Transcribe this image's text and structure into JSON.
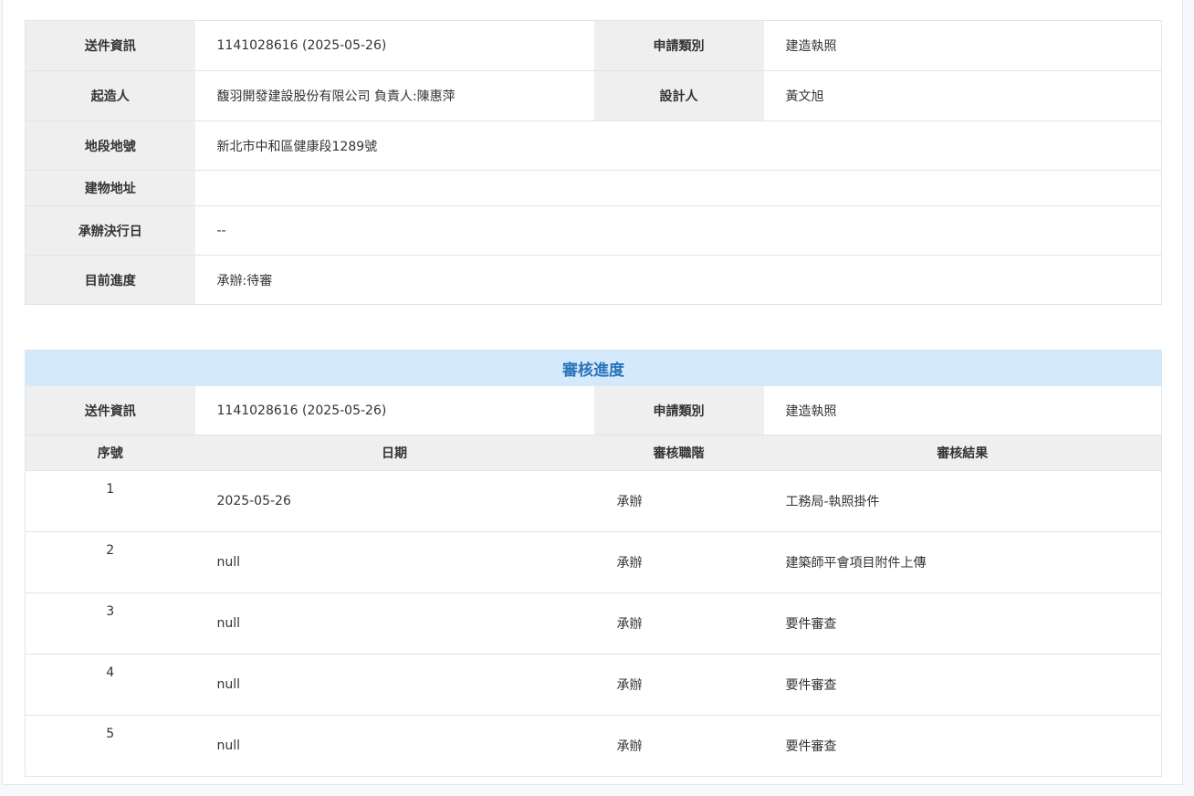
{
  "info": {
    "rows": [
      {
        "label": "送件資訊",
        "value": "1141028616 (2025-05-26)",
        "label2": "申請類別",
        "value2": "建造執照"
      },
      {
        "label": "起造人",
        "value": "馥羽開發建設股份有限公司 負責人:陳惠萍",
        "label2": "設計人",
        "value2": "黃文旭"
      },
      {
        "label": "地段地號",
        "value": "新北市中和區健康段1289號"
      },
      {
        "label": "建物地址",
        "value": ""
      },
      {
        "label": "承辦決行日",
        "value": "--"
      },
      {
        "label": "目前進度",
        "value": "承辦:待審"
      }
    ]
  },
  "review": {
    "title": "審核進度",
    "submit_label": "送件資訊",
    "submit_value": "1141028616 (2025-05-26)",
    "type_label": "申請類別",
    "type_value": "建造執照",
    "headers": [
      "序號",
      "日期",
      "審核職階",
      "審核結果"
    ],
    "rows": [
      {
        "seq": "1",
        "date": "2025-05-26",
        "role": "承辦",
        "result": "工務局-執照掛件"
      },
      {
        "seq": "2",
        "date": "null",
        "role": "承辦",
        "result": "建築師平會項目附件上傳"
      },
      {
        "seq": "3",
        "date": "null",
        "role": "承辦",
        "result": "要件審查"
      },
      {
        "seq": "4",
        "date": "null",
        "role": "承辦",
        "result": "要件審查"
      },
      {
        "seq": "5",
        "date": "null",
        "role": "承辦",
        "result": "要件審查"
      }
    ]
  }
}
